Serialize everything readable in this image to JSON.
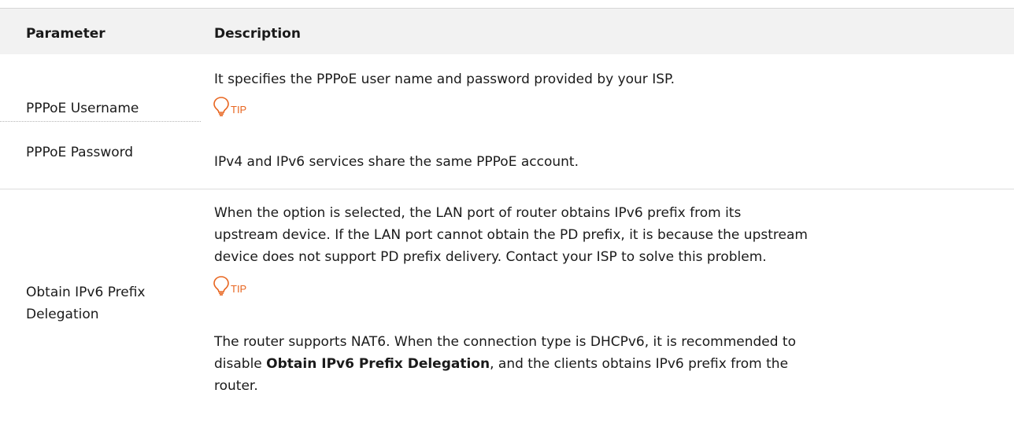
{
  "header": {
    "parameter": "Parameter",
    "description": "Description"
  },
  "rows": [
    {
      "params": [
        "PPPoE Username",
        "PPPoE Password"
      ],
      "description": "It specifies the PPPoE user name and password provided by your ISP.",
      "tip_label": "TIP",
      "tip_text": "IPv4 and IPv6 services share the same PPPoE account."
    },
    {
      "param_line1": "Obtain IPv6 Prefix",
      "param_line2": "Delegation",
      "description_lines": [
        "When the option is selected, the LAN port of router obtains IPv6 prefix from its",
        "upstream device. If the LAN port cannot obtain the PD prefix, it is because the upstream",
        "device does not support PD prefix delivery. Contact your ISP to solve this problem."
      ],
      "tip_label": "TIP",
      "tip_line1": "The router supports NAT6. When the connection type is DHCPv6, it is recommended to",
      "tip_line2_pre": "disable ",
      "tip_line2_bold": "Obtain IPv6 Prefix Delegation",
      "tip_line2_post": ", and the clients obtains IPv6 prefix from the",
      "tip_line3": "router."
    }
  ],
  "colors": {
    "tip_accent": "#e8651f",
    "header_bg": "#f2f2f2"
  },
  "icons": {
    "tip": "lightbulb-icon"
  }
}
